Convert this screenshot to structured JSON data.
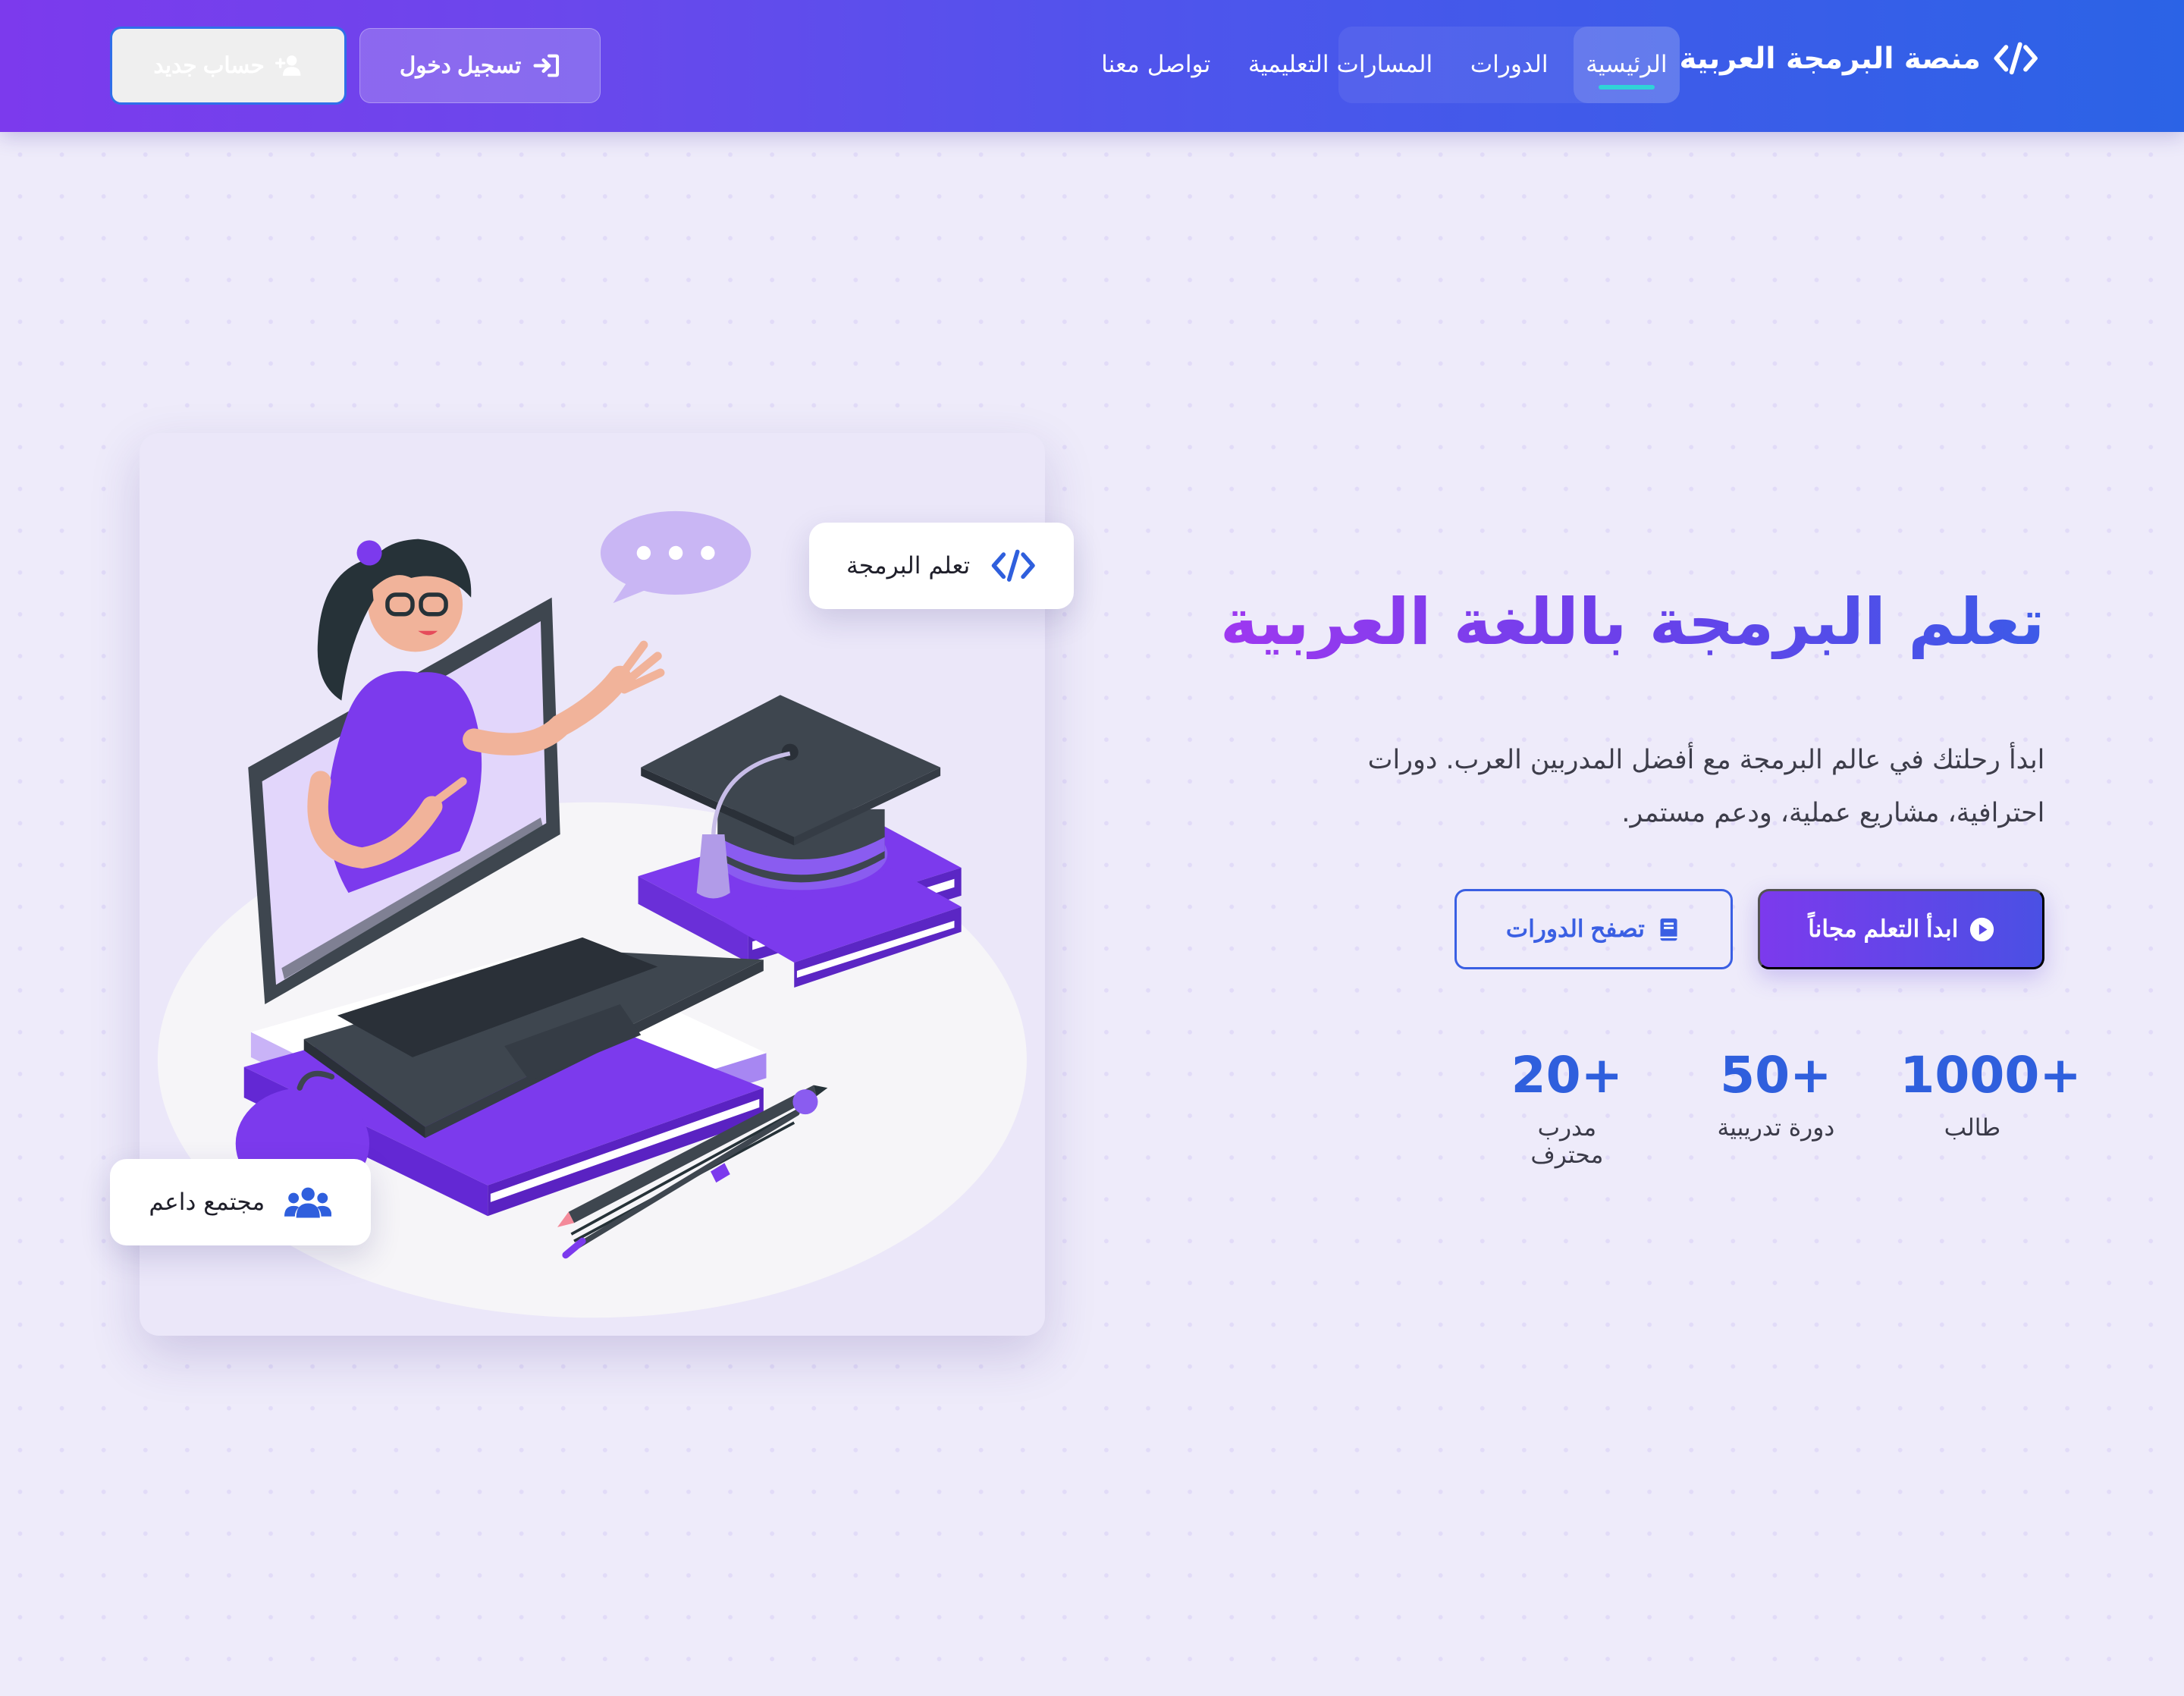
{
  "header": {
    "logo_text": "منصة البرمجة العربية",
    "logo_icon": "code-icon",
    "nav": [
      "الرئيسية",
      "الدورات",
      "المسارات التعليمية",
      "تواصل معنا"
    ],
    "active_nav": "الرئيسية",
    "login_label": "تسجيل دخول",
    "login_icon": "sign-in-icon",
    "register_label": "حساب جديد",
    "register_icon": "user-plus-icon"
  },
  "hero": {
    "title": "تعلم البرمجة باللغة العربية",
    "description": "ابدأ رحلتك في عالم البرمجة مع أفضل المدربين العرب. دورات احترافية، مشاريع عملية، ودعم مستمر.",
    "primary_button": "ابدأ التعلم مجاناً",
    "primary_icon": "play-circle-icon",
    "secondary_button": "تصفح الدورات",
    "secondary_icon": "book-icon",
    "stats": [
      {
        "value": "1000+",
        "label": "طالب"
      },
      {
        "value": "50+",
        "label": "دورة تدريبية"
      },
      {
        "value": "20+",
        "label": "مدرب محترف"
      }
    ]
  },
  "illustration": {
    "badge_code": "تعلم البرمجة",
    "badge_code_icon": "code-icon",
    "badge_community": "مجتمع داعم",
    "badge_community_icon": "users-icon"
  },
  "colors": {
    "header_gradient": [
      "#7c3aed",
      "#2b63e6"
    ],
    "accent": "#4a50e4",
    "stat_blue": "#2f5fdd",
    "active_underline": "#2fd3d7"
  }
}
